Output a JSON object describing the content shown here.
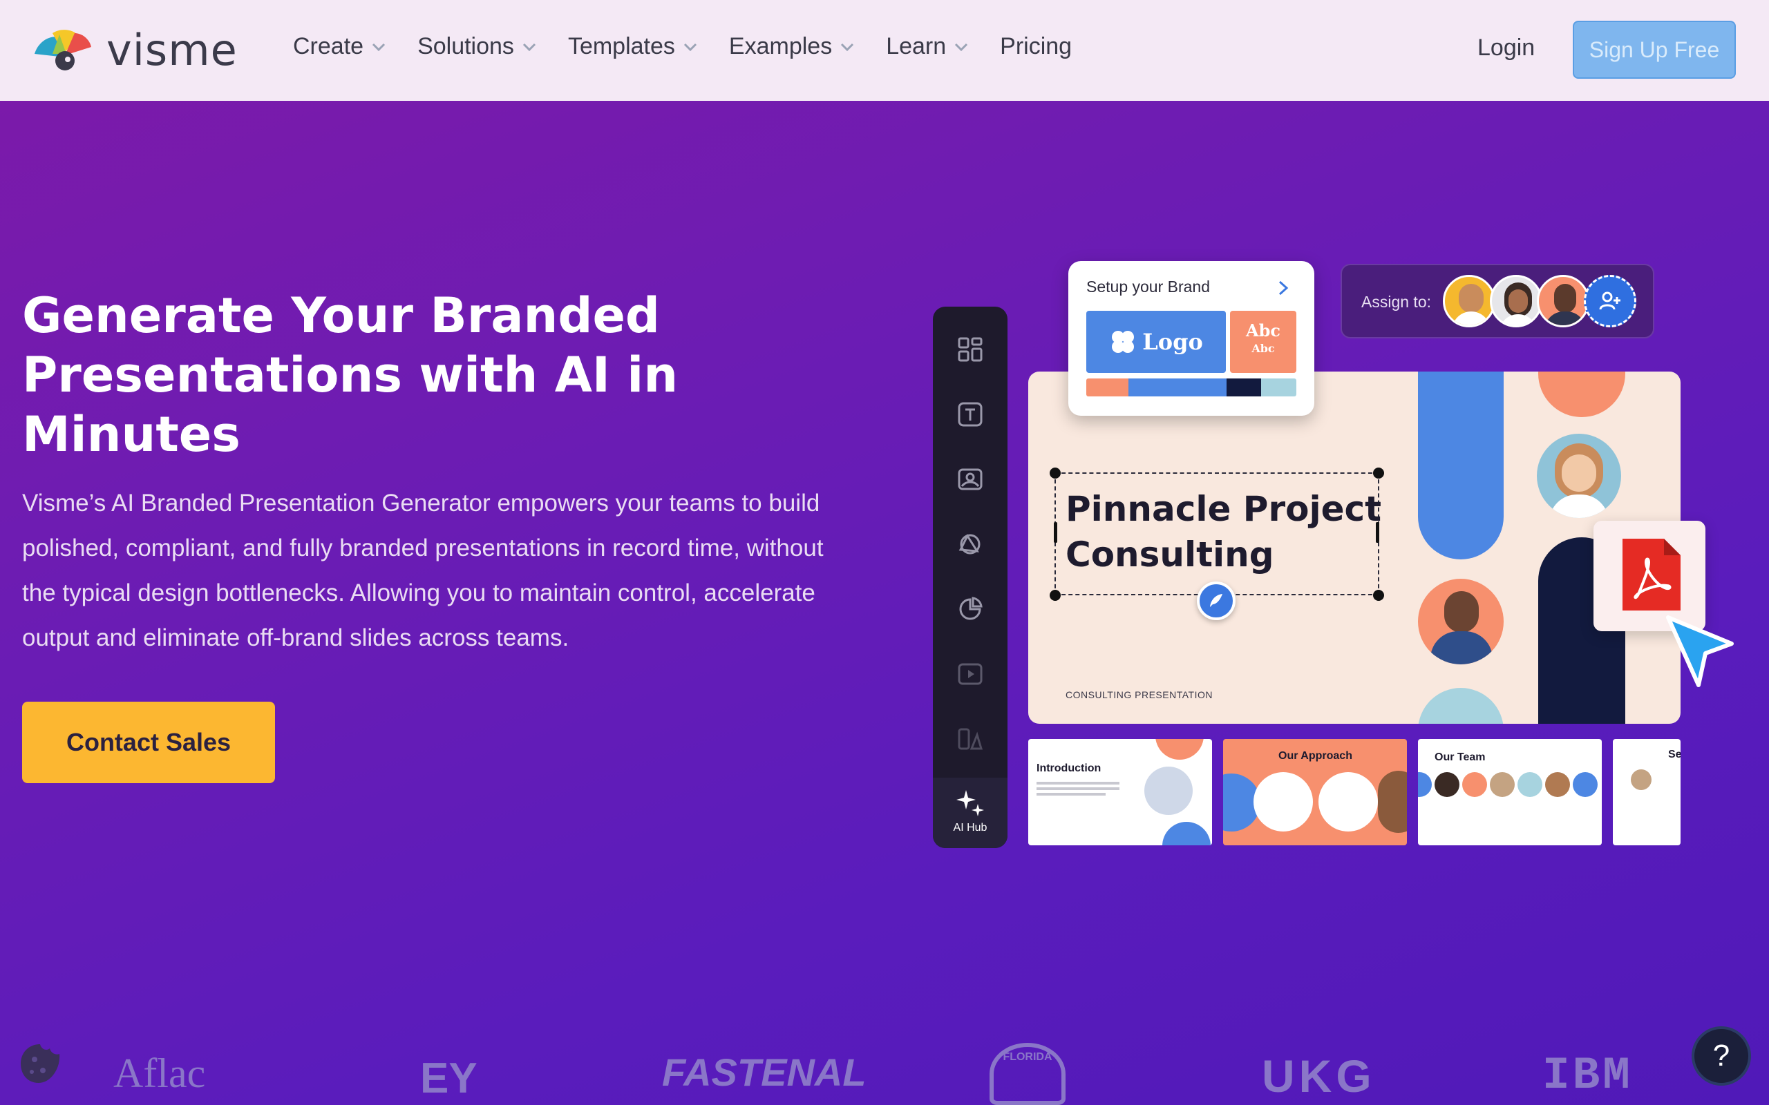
{
  "nav": {
    "logo_text": "visme",
    "items": [
      {
        "label": "Create",
        "has_dropdown": true
      },
      {
        "label": "Solutions",
        "has_dropdown": true
      },
      {
        "label": "Templates",
        "has_dropdown": true
      },
      {
        "label": "Examples",
        "has_dropdown": true
      },
      {
        "label": "Learn",
        "has_dropdown": true
      },
      {
        "label": "Pricing",
        "has_dropdown": false
      }
    ],
    "login": "Login",
    "signup": "Sign Up Free"
  },
  "hero": {
    "title": "Generate Your Branded Presentations with AI in Minutes",
    "description": "Visme’s AI Branded Presentation Generator empowers your teams to build polished, compliant, and fully branded presentations in record time, without the typical design bottlenecks. Allowing you to maintain control, accelerate output and eliminate off-brand slides across teams.",
    "cta": "Contact Sales"
  },
  "editor": {
    "toolbar_icons": [
      "grid-icon",
      "text-icon",
      "image-icon",
      "shapes-icon",
      "chart-icon",
      "video-icon",
      "assets-icon"
    ],
    "ai_hub_label": "AI Hub",
    "brand_card": {
      "title": "Setup your Brand",
      "logo_label": "Logo",
      "font_big": "Abc",
      "font_small": "Abc",
      "swatches": [
        "#f7906e",
        "#4d87e3",
        "#4d87e3",
        "#121a3e",
        "#a7d3df"
      ]
    },
    "assign_label": "Assign to:",
    "slide": {
      "title_line1": "Pinnacle Project",
      "title_line2": "Consulting",
      "subtitle": "CONSULTING PRESENTATION"
    },
    "thumbs": [
      {
        "title": "Introduction"
      },
      {
        "title": "Our Approach"
      },
      {
        "title": "Our Team"
      },
      {
        "title": "Se"
      }
    ]
  },
  "clients": [
    "Aflac",
    "EY",
    "FASTENAL",
    "FLORIDA",
    "UKG",
    "IBM"
  ],
  "help_label": "?",
  "colors": {
    "nav_bg": "#f4e9f5",
    "hero_bg": "#6c1cb3",
    "cta": "#fcb731",
    "signup": "#7fb6ee"
  }
}
